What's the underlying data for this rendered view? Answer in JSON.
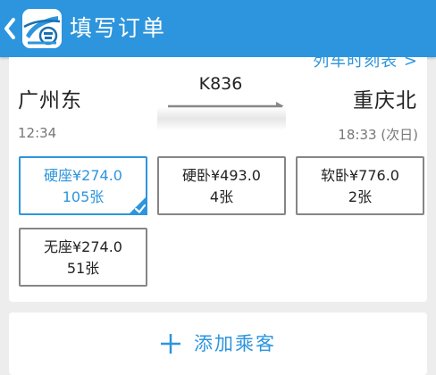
{
  "header": {
    "title": "填写订单"
  },
  "trip": {
    "timetable_link": "列车时刻表 >",
    "from_station": "广州东",
    "to_station": "重庆北",
    "train_no": "K836",
    "depart_time": "12:34",
    "arrive_time": "18:33 (次日)"
  },
  "seats": [
    {
      "name_price": "硬座¥274.0",
      "count": "105张",
      "selected": true
    },
    {
      "name_price": "硬卧¥493.0",
      "count": "4张",
      "selected": false
    },
    {
      "name_price": "软卧¥776.0",
      "count": "2张",
      "selected": false
    },
    {
      "name_price": "无座¥274.0",
      "count": "51张",
      "selected": false
    }
  ],
  "actions": {
    "add_passenger": "添加乘客"
  },
  "colors": {
    "primary": "#2d95dd",
    "border": "#858585",
    "background": "#ededed"
  },
  "icons": {
    "back": "chevron-left-icon",
    "logo": "railway-ticket-logo-icon",
    "check": "check-icon",
    "plus": "plus-icon"
  }
}
